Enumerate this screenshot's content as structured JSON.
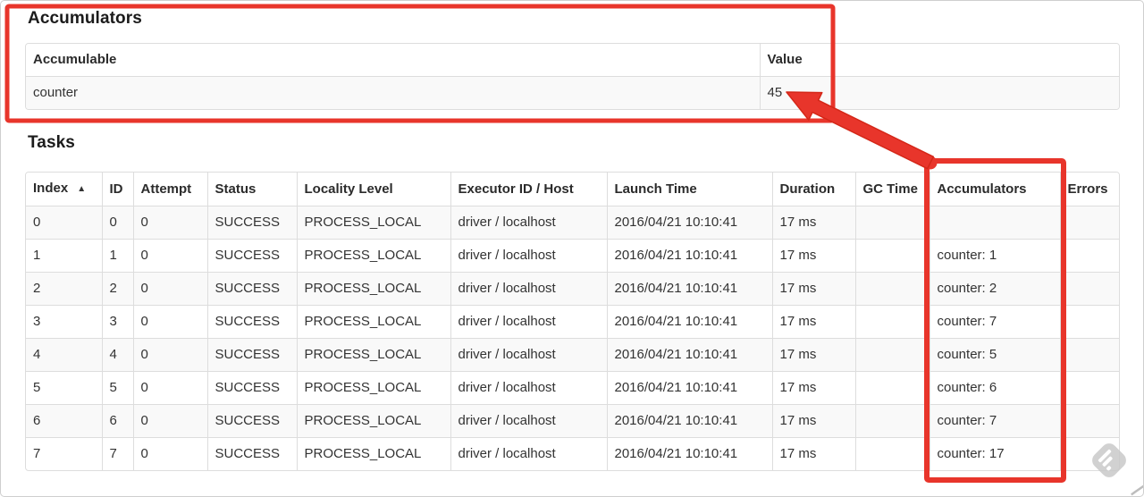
{
  "colors": {
    "annotation_red": "#e8352b",
    "annotation_red_dark": "#d42718",
    "table_border": "#dddddd",
    "stripe_background": "#f9f9f9",
    "watermark_gray": "#c9c9c9"
  },
  "icons": {
    "sort_ascending": "▲",
    "watermark": "skitch-watermark",
    "red_arrow": "points from tasks accumulators column to accumulator total value 45"
  },
  "accumulators_section": {
    "heading": "Accumulators",
    "table": {
      "columns": [
        "Accumulable",
        "Value"
      ],
      "rows": [
        [
          "counter",
          "45"
        ]
      ]
    }
  },
  "tasks_section": {
    "heading": "Tasks",
    "sort_indicator": "▲",
    "table": {
      "columns": [
        "Index",
        "ID",
        "Attempt",
        "Status",
        "Locality Level",
        "Executor ID / Host",
        "Launch Time",
        "Duration",
        "GC Time",
        "Accumulators",
        "Errors"
      ],
      "rows": [
        [
          "0",
          "0",
          "0",
          "SUCCESS",
          "PROCESS_LOCAL",
          "driver / localhost",
          "2016/04/21 10:10:41",
          "17 ms",
          "",
          "",
          ""
        ],
        [
          "1",
          "1",
          "0",
          "SUCCESS",
          "PROCESS_LOCAL",
          "driver / localhost",
          "2016/04/21 10:10:41",
          "17 ms",
          "",
          "counter: 1",
          ""
        ],
        [
          "2",
          "2",
          "0",
          "SUCCESS",
          "PROCESS_LOCAL",
          "driver / localhost",
          "2016/04/21 10:10:41",
          "17 ms",
          "",
          "counter: 2",
          ""
        ],
        [
          "3",
          "3",
          "0",
          "SUCCESS",
          "PROCESS_LOCAL",
          "driver / localhost",
          "2016/04/21 10:10:41",
          "17 ms",
          "",
          "counter: 7",
          ""
        ],
        [
          "4",
          "4",
          "0",
          "SUCCESS",
          "PROCESS_LOCAL",
          "driver / localhost",
          "2016/04/21 10:10:41",
          "17 ms",
          "",
          "counter: 5",
          ""
        ],
        [
          "5",
          "5",
          "0",
          "SUCCESS",
          "PROCESS_LOCAL",
          "driver / localhost",
          "2016/04/21 10:10:41",
          "17 ms",
          "",
          "counter: 6",
          ""
        ],
        [
          "6",
          "6",
          "0",
          "SUCCESS",
          "PROCESS_LOCAL",
          "driver / localhost",
          "2016/04/21 10:10:41",
          "17 ms",
          "",
          "counter: 7",
          ""
        ],
        [
          "7",
          "7",
          "0",
          "SUCCESS",
          "PROCESS_LOCAL",
          "driver / localhost",
          "2016/04/21 10:10:41",
          "17 ms",
          "",
          "counter: 17",
          ""
        ]
      ]
    }
  }
}
